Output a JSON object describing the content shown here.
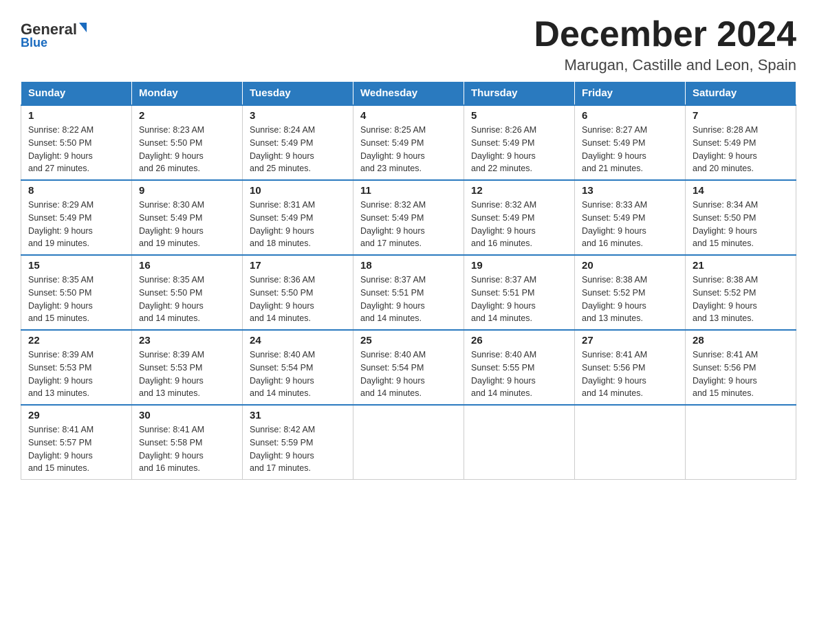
{
  "header": {
    "logo_general": "General",
    "logo_blue": "Blue",
    "title": "December 2024",
    "subtitle": "Marugan, Castille and Leon, Spain"
  },
  "days_of_week": [
    "Sunday",
    "Monday",
    "Tuesday",
    "Wednesday",
    "Thursday",
    "Friday",
    "Saturday"
  ],
  "weeks": [
    [
      {
        "day": "1",
        "sunrise": "8:22 AM",
        "sunset": "5:50 PM",
        "daylight": "9 hours and 27 minutes."
      },
      {
        "day": "2",
        "sunrise": "8:23 AM",
        "sunset": "5:50 PM",
        "daylight": "9 hours and 26 minutes."
      },
      {
        "day": "3",
        "sunrise": "8:24 AM",
        "sunset": "5:49 PM",
        "daylight": "9 hours and 25 minutes."
      },
      {
        "day": "4",
        "sunrise": "8:25 AM",
        "sunset": "5:49 PM",
        "daylight": "9 hours and 23 minutes."
      },
      {
        "day": "5",
        "sunrise": "8:26 AM",
        "sunset": "5:49 PM",
        "daylight": "9 hours and 22 minutes."
      },
      {
        "day": "6",
        "sunrise": "8:27 AM",
        "sunset": "5:49 PM",
        "daylight": "9 hours and 21 minutes."
      },
      {
        "day": "7",
        "sunrise": "8:28 AM",
        "sunset": "5:49 PM",
        "daylight": "9 hours and 20 minutes."
      }
    ],
    [
      {
        "day": "8",
        "sunrise": "8:29 AM",
        "sunset": "5:49 PM",
        "daylight": "9 hours and 19 minutes."
      },
      {
        "day": "9",
        "sunrise": "8:30 AM",
        "sunset": "5:49 PM",
        "daylight": "9 hours and 19 minutes."
      },
      {
        "day": "10",
        "sunrise": "8:31 AM",
        "sunset": "5:49 PM",
        "daylight": "9 hours and 18 minutes."
      },
      {
        "day": "11",
        "sunrise": "8:32 AM",
        "sunset": "5:49 PM",
        "daylight": "9 hours and 17 minutes."
      },
      {
        "day": "12",
        "sunrise": "8:32 AM",
        "sunset": "5:49 PM",
        "daylight": "9 hours and 16 minutes."
      },
      {
        "day": "13",
        "sunrise": "8:33 AM",
        "sunset": "5:49 PM",
        "daylight": "9 hours and 16 minutes."
      },
      {
        "day": "14",
        "sunrise": "8:34 AM",
        "sunset": "5:50 PM",
        "daylight": "9 hours and 15 minutes."
      }
    ],
    [
      {
        "day": "15",
        "sunrise": "8:35 AM",
        "sunset": "5:50 PM",
        "daylight": "9 hours and 15 minutes."
      },
      {
        "day": "16",
        "sunrise": "8:35 AM",
        "sunset": "5:50 PM",
        "daylight": "9 hours and 14 minutes."
      },
      {
        "day": "17",
        "sunrise": "8:36 AM",
        "sunset": "5:50 PM",
        "daylight": "9 hours and 14 minutes."
      },
      {
        "day": "18",
        "sunrise": "8:37 AM",
        "sunset": "5:51 PM",
        "daylight": "9 hours and 14 minutes."
      },
      {
        "day": "19",
        "sunrise": "8:37 AM",
        "sunset": "5:51 PM",
        "daylight": "9 hours and 14 minutes."
      },
      {
        "day": "20",
        "sunrise": "8:38 AM",
        "sunset": "5:52 PM",
        "daylight": "9 hours and 13 minutes."
      },
      {
        "day": "21",
        "sunrise": "8:38 AM",
        "sunset": "5:52 PM",
        "daylight": "9 hours and 13 minutes."
      }
    ],
    [
      {
        "day": "22",
        "sunrise": "8:39 AM",
        "sunset": "5:53 PM",
        "daylight": "9 hours and 13 minutes."
      },
      {
        "day": "23",
        "sunrise": "8:39 AM",
        "sunset": "5:53 PM",
        "daylight": "9 hours and 13 minutes."
      },
      {
        "day": "24",
        "sunrise": "8:40 AM",
        "sunset": "5:54 PM",
        "daylight": "9 hours and 14 minutes."
      },
      {
        "day": "25",
        "sunrise": "8:40 AM",
        "sunset": "5:54 PM",
        "daylight": "9 hours and 14 minutes."
      },
      {
        "day": "26",
        "sunrise": "8:40 AM",
        "sunset": "5:55 PM",
        "daylight": "9 hours and 14 minutes."
      },
      {
        "day": "27",
        "sunrise": "8:41 AM",
        "sunset": "5:56 PM",
        "daylight": "9 hours and 14 minutes."
      },
      {
        "day": "28",
        "sunrise": "8:41 AM",
        "sunset": "5:56 PM",
        "daylight": "9 hours and 15 minutes."
      }
    ],
    [
      {
        "day": "29",
        "sunrise": "8:41 AM",
        "sunset": "5:57 PM",
        "daylight": "9 hours and 15 minutes."
      },
      {
        "day": "30",
        "sunrise": "8:41 AM",
        "sunset": "5:58 PM",
        "daylight": "9 hours and 16 minutes."
      },
      {
        "day": "31",
        "sunrise": "8:42 AM",
        "sunset": "5:59 PM",
        "daylight": "9 hours and 17 minutes."
      },
      null,
      null,
      null,
      null
    ]
  ],
  "labels": {
    "sunrise": "Sunrise:",
    "sunset": "Sunset:",
    "daylight": "Daylight:"
  }
}
